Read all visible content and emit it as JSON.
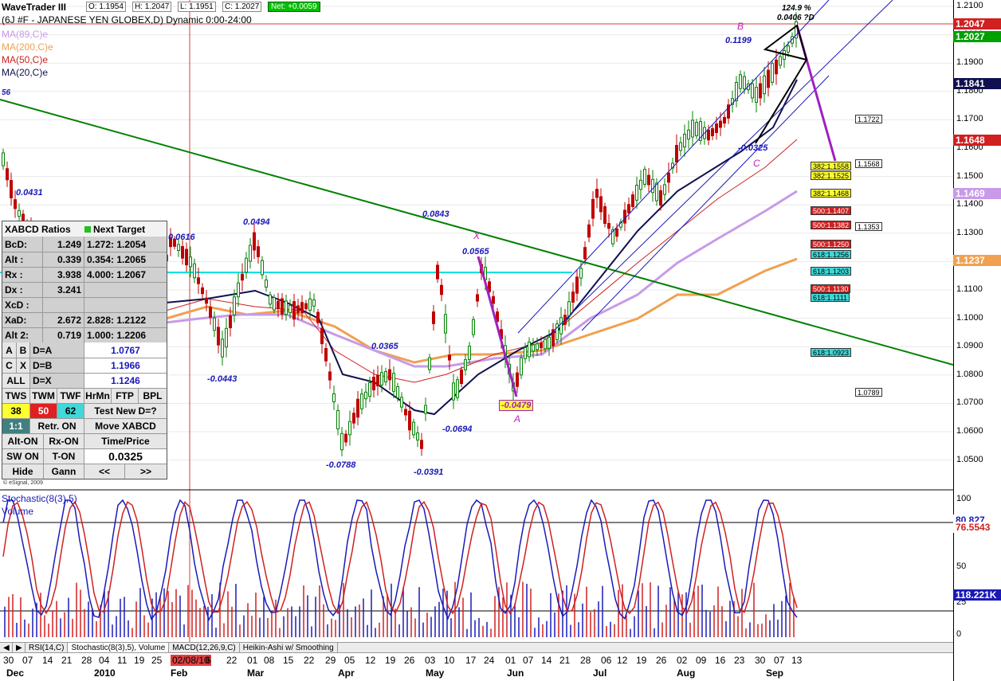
{
  "window": {
    "title": "WaveTrader III",
    "symbol_line": "(6J #F - JAPANESE YEN GLOBEX,D) Dynamic 0:00-24:00"
  },
  "ohlc": {
    "open": "O: 1.1954",
    "high": "H: 1.2047",
    "low": "L: 1.1951",
    "close": "C: 1.2027",
    "net": "Net: +0.0059"
  },
  "moving_averages": [
    {
      "label": "MA(89,C)e",
      "color": "#c89ae8"
    },
    {
      "label": "MA(200,C)e",
      "color": "#f0a050"
    },
    {
      "label": "MA(50,C)e",
      "color": "#d02020"
    },
    {
      "label": "MA(20,C)e",
      "color": "#101050"
    }
  ],
  "xabcd_panel": {
    "title": "XABCD Ratios",
    "next_target": "Next Target",
    "ratios": [
      {
        "k": "BcD:",
        "v": "1.249",
        "t": "1.272: 1.2054"
      },
      {
        "k": "Alt :",
        "v": "0.339",
        "t": "0.354: 1.2065"
      },
      {
        "k": "Rx  :",
        "v": "3.938",
        "t": "4.000: 1.2067"
      },
      {
        "k": "Dx  :",
        "v": "3.241",
        "t": ""
      },
      {
        "k": "XcD :",
        "v": "",
        "t": ""
      },
      {
        "k": "XaD:",
        "v": "2.672",
        "t": "2.828: 1.2122"
      },
      {
        "k": "Alt 2:",
        "v": "0.719",
        "t": "1.000: 1.2206"
      }
    ],
    "eq": [
      {
        "a": "A",
        "b": "B",
        "c": "D=A",
        "v": "1.0767"
      },
      {
        "a": "C",
        "b": "X",
        "c": "D=B",
        "v": "1.1966"
      },
      {
        "a": "ALL",
        "b": "",
        "c": "D=X",
        "v": "1.1246"
      }
    ],
    "btn_row1": [
      "TWS",
      "TWM",
      "TWF",
      "HrMn",
      "FTP",
      "BPL"
    ],
    "tws_val": "38",
    "twm_val": "50",
    "twf_val": "62",
    "test_new": "Test New D=?",
    "one_one": "1:1",
    "retr_on": "Retr. ON",
    "move_xabcd": "Move XABCD",
    "alt_on": "Alt-ON",
    "rx_on": "Rx-ON",
    "time_price": "Time/Price",
    "sw_on": "SW ON",
    "t_on": "T-ON",
    "value": "0.0325",
    "hide": "Hide",
    "gann": "Gann",
    "prev": "<<",
    "next": ">>",
    "copyright": "© eSignal, 2009"
  },
  "price_axis": {
    "ticks": [
      "1.2100",
      "1.2000",
      "1.1900",
      "1.1800",
      "1.1700",
      "1.1600",
      "1.1500",
      "1.1400",
      "1.1300",
      "1.1200",
      "1.1100",
      "1.1000",
      "1.0900",
      "1.0800",
      "1.0700",
      "1.0600",
      "1.0500"
    ],
    "tags": [
      {
        "text": "1.2047",
        "bg": "#d02020",
        "fg": "#ffffff"
      },
      {
        "text": "1.2027",
        "bg": "#00a000",
        "fg": "#ffffff"
      },
      {
        "text": "1.1841",
        "bg": "#101050",
        "fg": "#ffffff"
      },
      {
        "text": "1.1648",
        "bg": "#d02020",
        "fg": "#ffffff"
      },
      {
        "text": "1.1469",
        "bg": "#c89ae8",
        "fg": "#ffffff"
      },
      {
        "text": "1.1237",
        "bg": "#f0a050",
        "fg": "#ffffff"
      }
    ]
  },
  "stoch_axis": {
    "ticks": [
      "100",
      "50",
      "25",
      "0"
    ],
    "tags": [
      {
        "text": "80.827",
        "bg": "#ffffff",
        "fg": "#1a1ab8"
      },
      {
        "text": "76.5543",
        "bg": "#ffffff",
        "fg": "#d02020"
      },
      {
        "text": "118.221K",
        "bg": "#1a1ab8",
        "fg": "#ffffff"
      }
    ]
  },
  "stoch_label": "Stochastic(8(3),5)",
  "volume_label": "Volume",
  "pivot_labels": {
    "p1": "0.0431",
    "p2": "0.0616",
    "p3": "0.0494",
    "p4": "-0.0443",
    "p5": "0.0365",
    "p6": "-0.0788",
    "p7": "0.0843",
    "p8": "-0.0391",
    "p9": "-0.0694",
    "p10": "0.0565",
    "p11": "-0.0479",
    "p12": "0.1199",
    "p13": "-0.0325",
    "p14": "124.9 %",
    "p15": "0.0406 ?D",
    "p16": "56"
  },
  "pattern_letters": {
    "x": "X",
    "a": "A",
    "b": "B",
    "c": "C"
  },
  "targets": [
    {
      "text": "382:1.1558",
      "bg": "#ffff30",
      "fg": "#000"
    },
    {
      "text": "382:1.1525",
      "bg": "#ffff30",
      "fg": "#000"
    },
    {
      "text": "382:1.1468",
      "bg": "#ffff30",
      "fg": "#000"
    },
    {
      "text": "500:1.1407",
      "bg": "#d02020",
      "fg": "#fff"
    },
    {
      "text": "500:1.1382",
      "bg": "#d02020",
      "fg": "#fff"
    },
    {
      "text": "500:1.1250",
      "bg": "#d02020",
      "fg": "#fff"
    },
    {
      "text": "618:1.1256",
      "bg": "#40d8d8",
      "fg": "#000"
    },
    {
      "text": "618:1.1203",
      "bg": "#40d8d8",
      "fg": "#000"
    },
    {
      "text": "500:1.1130",
      "bg": "#d02020",
      "fg": "#fff"
    },
    {
      "text": "618:1.1111",
      "bg": "#40d8d8",
      "fg": "#000"
    },
    {
      "text": "618:1.0923",
      "bg": "#40d8d8",
      "fg": "#000"
    }
  ],
  "side_labels": [
    "1.1722",
    "1.1568",
    "1.1353",
    "1.0789"
  ],
  "tabs": [
    "RSI(14,C)",
    "Stochastic(8(3),5), Volume",
    "MACD(12,26,9,C)",
    "Heikin-Ashi w/ Smoothing"
  ],
  "x_days": [
    "30",
    "07",
    "14",
    "21",
    "28",
    "04",
    "11",
    "19",
    "25",
    "02/08/10",
    "6",
    "22",
    "01",
    "08",
    "15",
    "22",
    "29",
    "05",
    "12",
    "19",
    "26",
    "03",
    "10",
    "17",
    "24",
    "01",
    "07",
    "14",
    "21",
    "28",
    "06",
    "12",
    "19",
    "26",
    "02",
    "09",
    "16",
    "23",
    "30",
    "07",
    "13"
  ],
  "x_months": [
    "Dec",
    "2010",
    "Feb",
    "Mar",
    "Apr",
    "May",
    "Jun",
    "Jul",
    "Aug",
    "Sep"
  ],
  "colors": {
    "grid": "#e8e8e8",
    "bull": "#008000",
    "bear": "#c00000",
    "trend": "#008000",
    "channel": "#1a1ab8",
    "cyan": "#00e0e0",
    "pattern": "#a020c0"
  }
}
